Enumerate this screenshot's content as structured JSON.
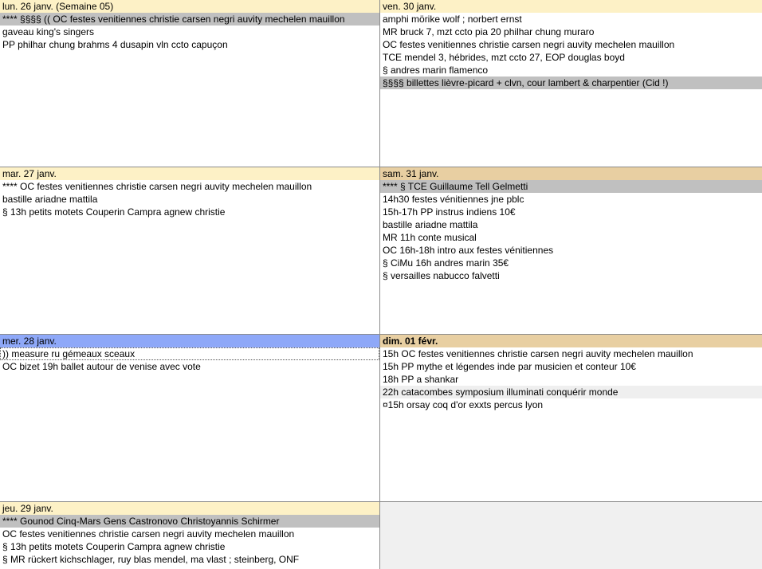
{
  "days": [
    {
      "header": "lun. 26 janv. (Semaine 05)",
      "events": [
        "**** §§§§ (( OC festes venitiennes christie carsen negri auvity mechelen mauillon",
        "gaveau king's singers",
        "PP philhar chung brahms 4 dusapin vln ccto capuçon"
      ]
    },
    {
      "header": "ven. 30 janv.",
      "events": [
        "amphi mörike wolf ; norbert ernst",
        "MR bruck 7, mzt ccto pia 20 philhar chung muraro",
        "OC festes venitiennes christie carsen negri auvity mechelen mauillon",
        "TCE mendel 3, hébrides, mzt ccto 27, EOP douglas boyd",
        "§ andres marin flamenco",
        "§§§§ billettes lièvre-picard + clvn, cour lambert & charpentier (Cid !)"
      ]
    },
    {
      "header": "mar. 27 janv.",
      "events": [
        "**** OC festes venitiennes christie carsen negri auvity mechelen mauillon",
        "bastille ariadne mattila",
        "§ 13h petits motets Couperin Campra agnew christie"
      ]
    },
    {
      "header": "sam. 31 janv.",
      "events": [
        "**** § TCE Guillaume Tell Gelmetti",
        "14h30 festes vénitiennes jne pblc",
        "15h-17h PP instrus indiens 10€",
        "bastille ariadne mattila",
        "MR 11h conte musical",
        "OC 16h-18h intro aux festes vénitiennes",
        "§ CiMu 16h andres marin 35€",
        "§ versailles nabucco falvetti"
      ]
    },
    {
      "header": "mer. 28 janv.",
      "events": [
        ")) measure ru gémeaux sceaux",
        "OC bizet 19h ballet autour de venise avec vote"
      ]
    },
    {
      "header": "dim. 01 févr.",
      "events": [
        "15h OC festes venitiennes christie carsen negri auvity mechelen mauillon",
        "15h PP mythe et légendes inde par musicien et conteur 10€",
        "18h PP a shankar",
        "22h catacombes symposium illuminati conquérir monde",
        "¤15h orsay coq d'or exxts percus lyon"
      ]
    },
    {
      "header": "jeu. 29 janv.",
      "events": [
        "**** Gounod Cinq-Mars Gens Castronovo Christoyannis Schirmer",
        "OC festes venitiennes christie carsen negri auvity mechelen mauillon",
        "§ 13h petits motets Couperin Campra agnew christie",
        "§ MR rückert kichschlager, ruy blas mendel, ma vlast ; steinberg, ONF"
      ]
    }
  ],
  "colors": {
    "header_weekday": "#fdf1c6",
    "header_weekend": "#e8cfa2",
    "header_selected": "#8ea8f8",
    "event_highlight": "#c0c0c0",
    "event_light": "#efefef"
  }
}
